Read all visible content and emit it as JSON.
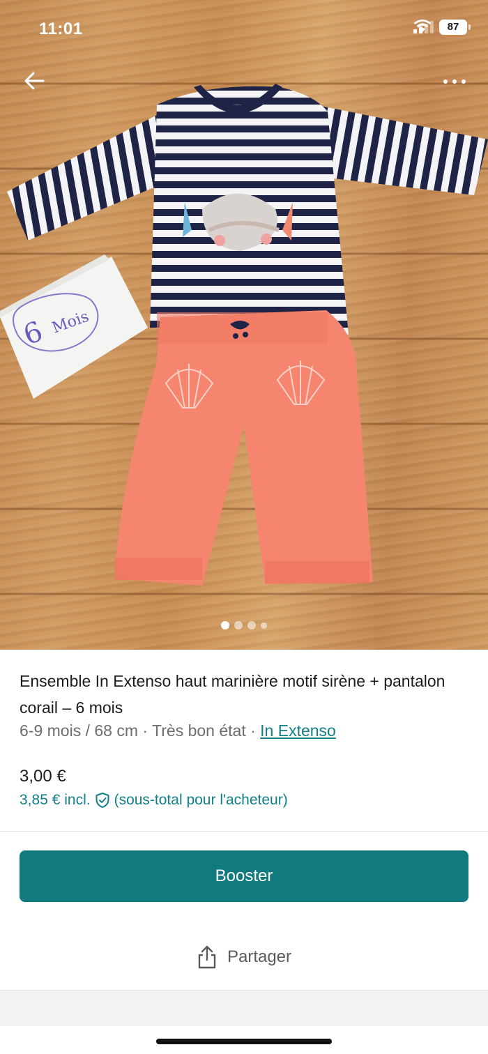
{
  "status_bar": {
    "time": "11:01",
    "battery": "87"
  },
  "photo": {
    "note_text": "6 Mois",
    "page_count": 4,
    "current_page": 1
  },
  "listing": {
    "title": "Ensemble In Extenso haut marinière motif sirène + pantalon corail – 6 mois",
    "size": "6-9 mois / 68 cm",
    "separator": "·",
    "condition": "Très bon état",
    "brand": "In Extenso",
    "price": "3,00 €",
    "price_incl": "3,85 € incl.",
    "price_incl_note": "(sous-total pour l'acheteur)"
  },
  "actions": {
    "booster_label": "Booster",
    "share_label": "Partager"
  },
  "colors": {
    "accent": "#117a7e",
    "link": "#127f87",
    "pants": "#f5856f",
    "stripes": "#1f2446"
  }
}
